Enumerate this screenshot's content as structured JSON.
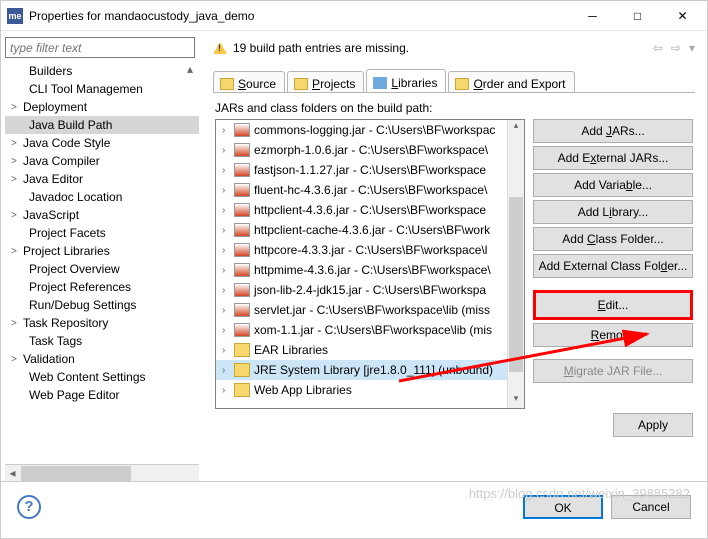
{
  "window": {
    "title": "Properties for mandaocustody_java_demo"
  },
  "filter": {
    "placeholder": "type filter text"
  },
  "nav": {
    "items": [
      {
        "label": "Builders",
        "child": true
      },
      {
        "label": "CLI Tool Managemen",
        "child": true
      },
      {
        "label": "Deployment",
        "exp": ">"
      },
      {
        "label": "Java Build Path",
        "child": true,
        "sel": true
      },
      {
        "label": "Java Code Style",
        "exp": ">"
      },
      {
        "label": "Java Compiler",
        "exp": ">"
      },
      {
        "label": "Java Editor",
        "exp": ">"
      },
      {
        "label": "Javadoc Location",
        "child": true
      },
      {
        "label": "JavaScript",
        "exp": ">"
      },
      {
        "label": "Project Facets",
        "child": true
      },
      {
        "label": "Project Libraries",
        "exp": ">"
      },
      {
        "label": "Project Overview",
        "child": true
      },
      {
        "label": "Project References",
        "child": true
      },
      {
        "label": "Run/Debug Settings",
        "child": true
      },
      {
        "label": "Task Repository",
        "exp": ">"
      },
      {
        "label": "Task Tags",
        "child": true
      },
      {
        "label": "Validation",
        "exp": ">"
      },
      {
        "label": "Web Content Settings",
        "child": true
      },
      {
        "label": "Web Page Editor",
        "child": true
      }
    ],
    "scroll_up": "▴"
  },
  "warning": {
    "text": "19 build path entries are missing."
  },
  "tabs": {
    "items": [
      {
        "label": "Source",
        "u": "S"
      },
      {
        "label": "Projects",
        "u": "P"
      },
      {
        "label": "Libraries",
        "u": "L",
        "active": true
      },
      {
        "label": "Order and Export",
        "u": "O"
      }
    ]
  },
  "jars": {
    "desc": "JARs and class folders on the build path:",
    "items": [
      {
        "icon": "jar",
        "label": "commons-logging.jar - C:\\Users\\BF\\workspac"
      },
      {
        "icon": "jar",
        "label": "ezmorph-1.0.6.jar - C:\\Users\\BF\\workspace\\"
      },
      {
        "icon": "jar",
        "label": "fastjson-1.1.27.jar - C:\\Users\\BF\\workspace"
      },
      {
        "icon": "jar",
        "label": "fluent-hc-4.3.6.jar - C:\\Users\\BF\\workspace\\"
      },
      {
        "icon": "jar",
        "label": "httpclient-4.3.6.jar - C:\\Users\\BF\\workspace"
      },
      {
        "icon": "jar",
        "label": "httpclient-cache-4.3.6.jar - C:\\Users\\BF\\work"
      },
      {
        "icon": "jar",
        "label": "httpcore-4.3.3.jar - C:\\Users\\BF\\workspace\\l"
      },
      {
        "icon": "jar",
        "label": "httpmime-4.3.6.jar - C:\\Users\\BF\\workspace\\"
      },
      {
        "icon": "jar",
        "label": "json-lib-2.4-jdk15.jar - C:\\Users\\BF\\workspa"
      },
      {
        "icon": "jar",
        "label": "servlet.jar - C:\\Users\\BF\\workspace\\lib (miss"
      },
      {
        "icon": "jar",
        "label": "xom-1.1.jar - C:\\Users\\BF\\workspace\\lib (mis"
      },
      {
        "icon": "lib",
        "label": "EAR Libraries"
      },
      {
        "icon": "lib",
        "label": "JRE System Library [jre1.8.0_111] (unbound)",
        "sel": true
      },
      {
        "icon": "lib",
        "label": "Web App Libraries"
      }
    ]
  },
  "buttons": {
    "add_jars": "Add JARs...",
    "add_ext_jars": "Add External JARs...",
    "add_var": "Add Variable...",
    "add_lib": "Add Library...",
    "add_class": "Add Class Folder...",
    "add_ext_class": "Add External Class Folder...",
    "edit": "Edit...",
    "remove": "Remove",
    "migrate": "Migrate JAR File...",
    "apply": "Apply",
    "ok": "OK",
    "cancel": "Cancel"
  },
  "watermark": "https://blog.csdn.net/weixin_39885282"
}
